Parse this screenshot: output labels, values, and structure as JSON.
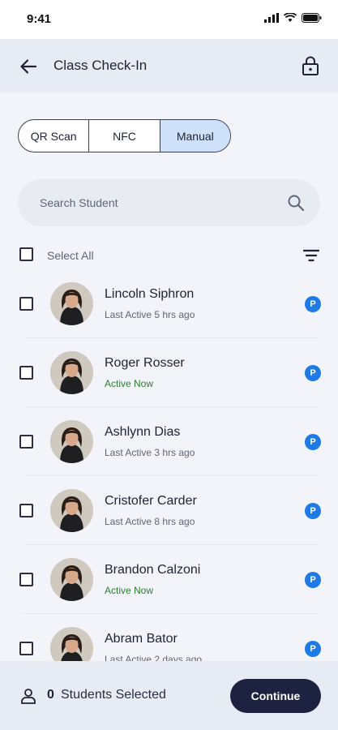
{
  "status_bar": {
    "time": "9:41"
  },
  "header": {
    "title": "Class Check-In"
  },
  "tabs": [
    {
      "label": "QR Scan",
      "active": false
    },
    {
      "label": "NFC",
      "active": false
    },
    {
      "label": "Manual",
      "active": true
    }
  ],
  "search": {
    "placeholder": "Search Student"
  },
  "select_all": {
    "label": "Select All"
  },
  "students": [
    {
      "name": "Lincoln Siphron",
      "status": "Last Active 5 hrs ago",
      "active": false,
      "badge": "P"
    },
    {
      "name": "Roger Rosser",
      "status": "Active Now",
      "active": true,
      "badge": "P"
    },
    {
      "name": "Ashlynn Dias",
      "status": "Last Active 3 hrs ago",
      "active": false,
      "badge": "P"
    },
    {
      "name": "Cristofer Carder",
      "status": "Last Active 8 hrs ago",
      "active": false,
      "badge": "P"
    },
    {
      "name": "Brandon Calzoni",
      "status": "Active Now",
      "active": true,
      "badge": "P"
    },
    {
      "name": "Abram Bator",
      "status": "Last Active 2 days ago",
      "active": false,
      "badge": "P"
    }
  ],
  "footer": {
    "count": "0",
    "label": "Students Selected",
    "continue_label": "Continue"
  },
  "colors": {
    "accent": "#1f7ae6",
    "primary_button": "#1c2240",
    "active_status": "#2e7d32",
    "active_tab": "#cfe0fb"
  }
}
